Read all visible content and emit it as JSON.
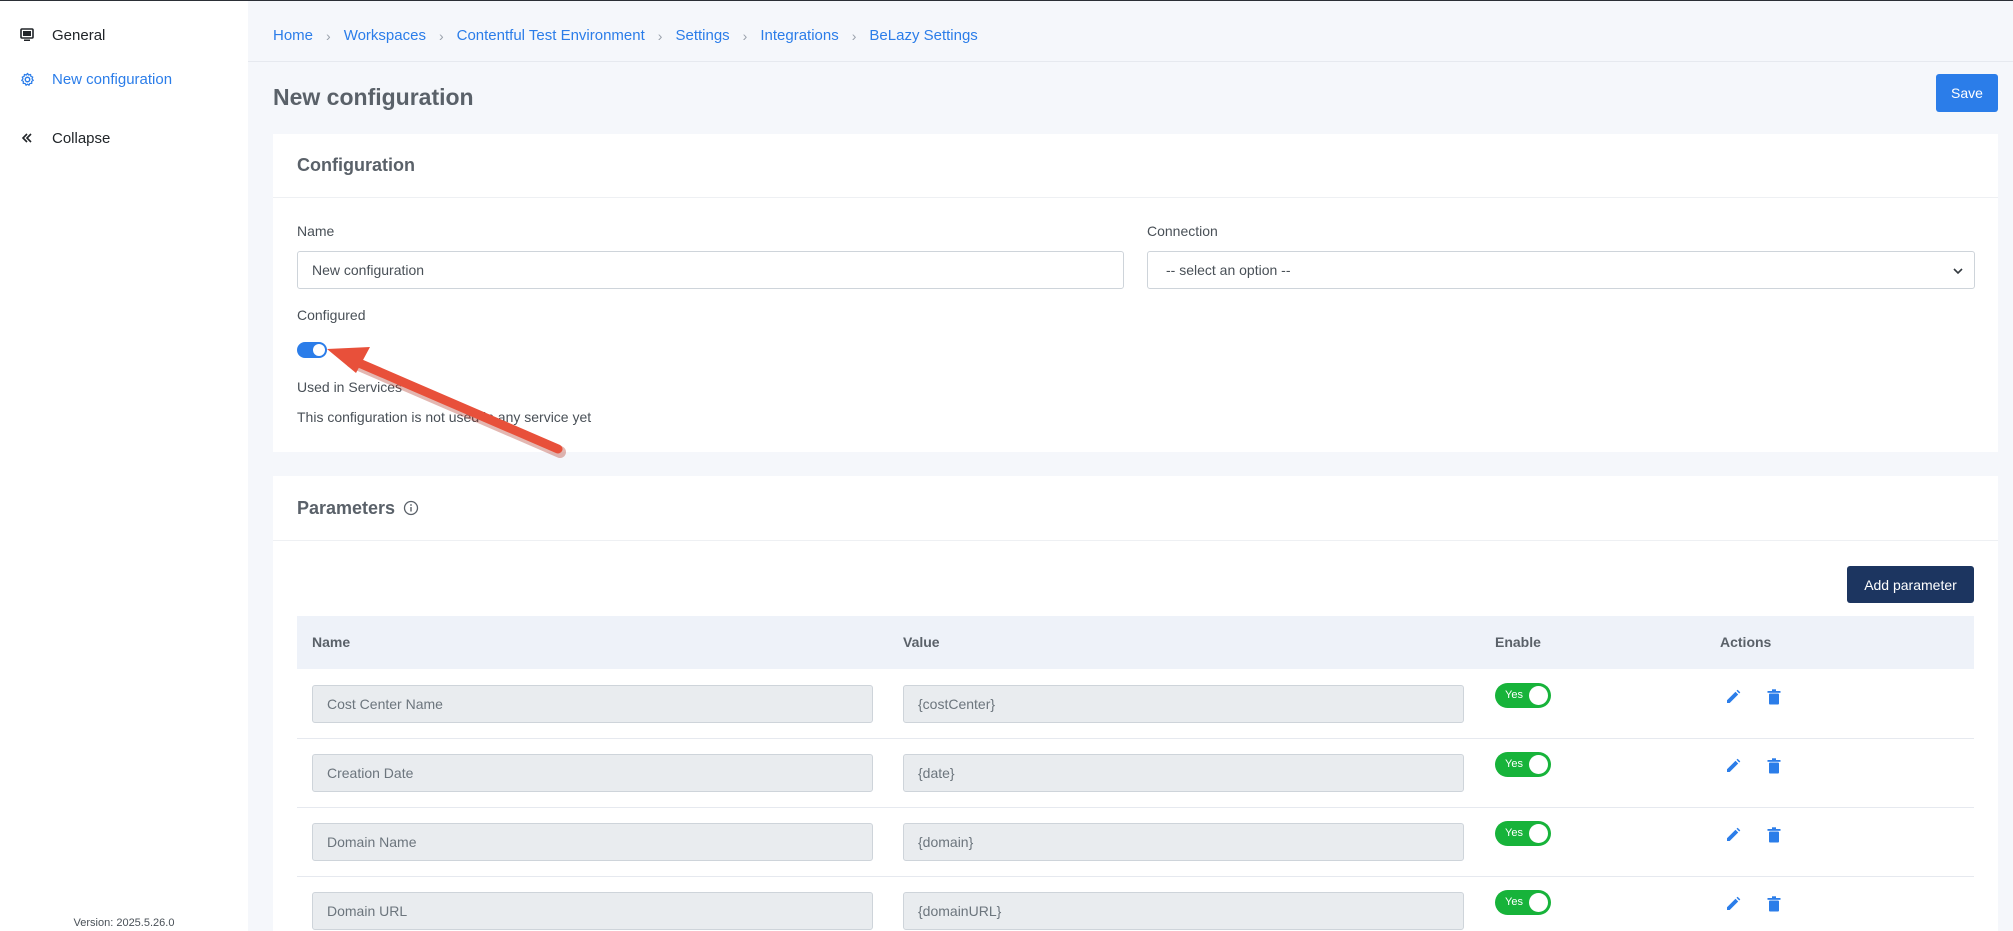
{
  "sidebar": {
    "items": [
      {
        "label": "General",
        "icon": "monitor-icon"
      },
      {
        "label": "New configuration",
        "icon": "gear-icon"
      },
      {
        "label": "Collapse",
        "icon": "double-chevron-left-icon"
      }
    ],
    "version": "Version: 2025.5.26.0"
  },
  "breadcrumb": [
    "Home",
    "Workspaces",
    "Contentful Test Environment",
    "Settings",
    "Integrations",
    "BeLazy Settings"
  ],
  "page": {
    "title": "New configuration",
    "save_label": "Save"
  },
  "configuration": {
    "header": "Configuration",
    "name_label": "Name",
    "name_value": "New configuration",
    "connection_label": "Connection",
    "connection_value": "-- select an option --",
    "configured_label": "Configured",
    "configured_on": true,
    "used_in_label": "Used in Services",
    "used_in_text": "This configuration is not used in any service yet"
  },
  "parameters": {
    "header": "Parameters",
    "add_label": "Add parameter",
    "columns": [
      "Name",
      "Value",
      "Enable",
      "Actions"
    ],
    "rows": [
      {
        "name": "Cost Center Name",
        "value": "{costCenter}",
        "enable": "Yes"
      },
      {
        "name": "Creation Date",
        "value": "{date}",
        "enable": "Yes"
      },
      {
        "name": "Domain Name",
        "value": "{domain}",
        "enable": "Yes"
      },
      {
        "name": "Domain URL",
        "value": "{domainURL}",
        "enable": "Yes"
      }
    ]
  },
  "colors": {
    "accent": "#2b7de9",
    "navy": "#1c3560",
    "green": "#17b33a",
    "arrow": "#e8503a"
  }
}
